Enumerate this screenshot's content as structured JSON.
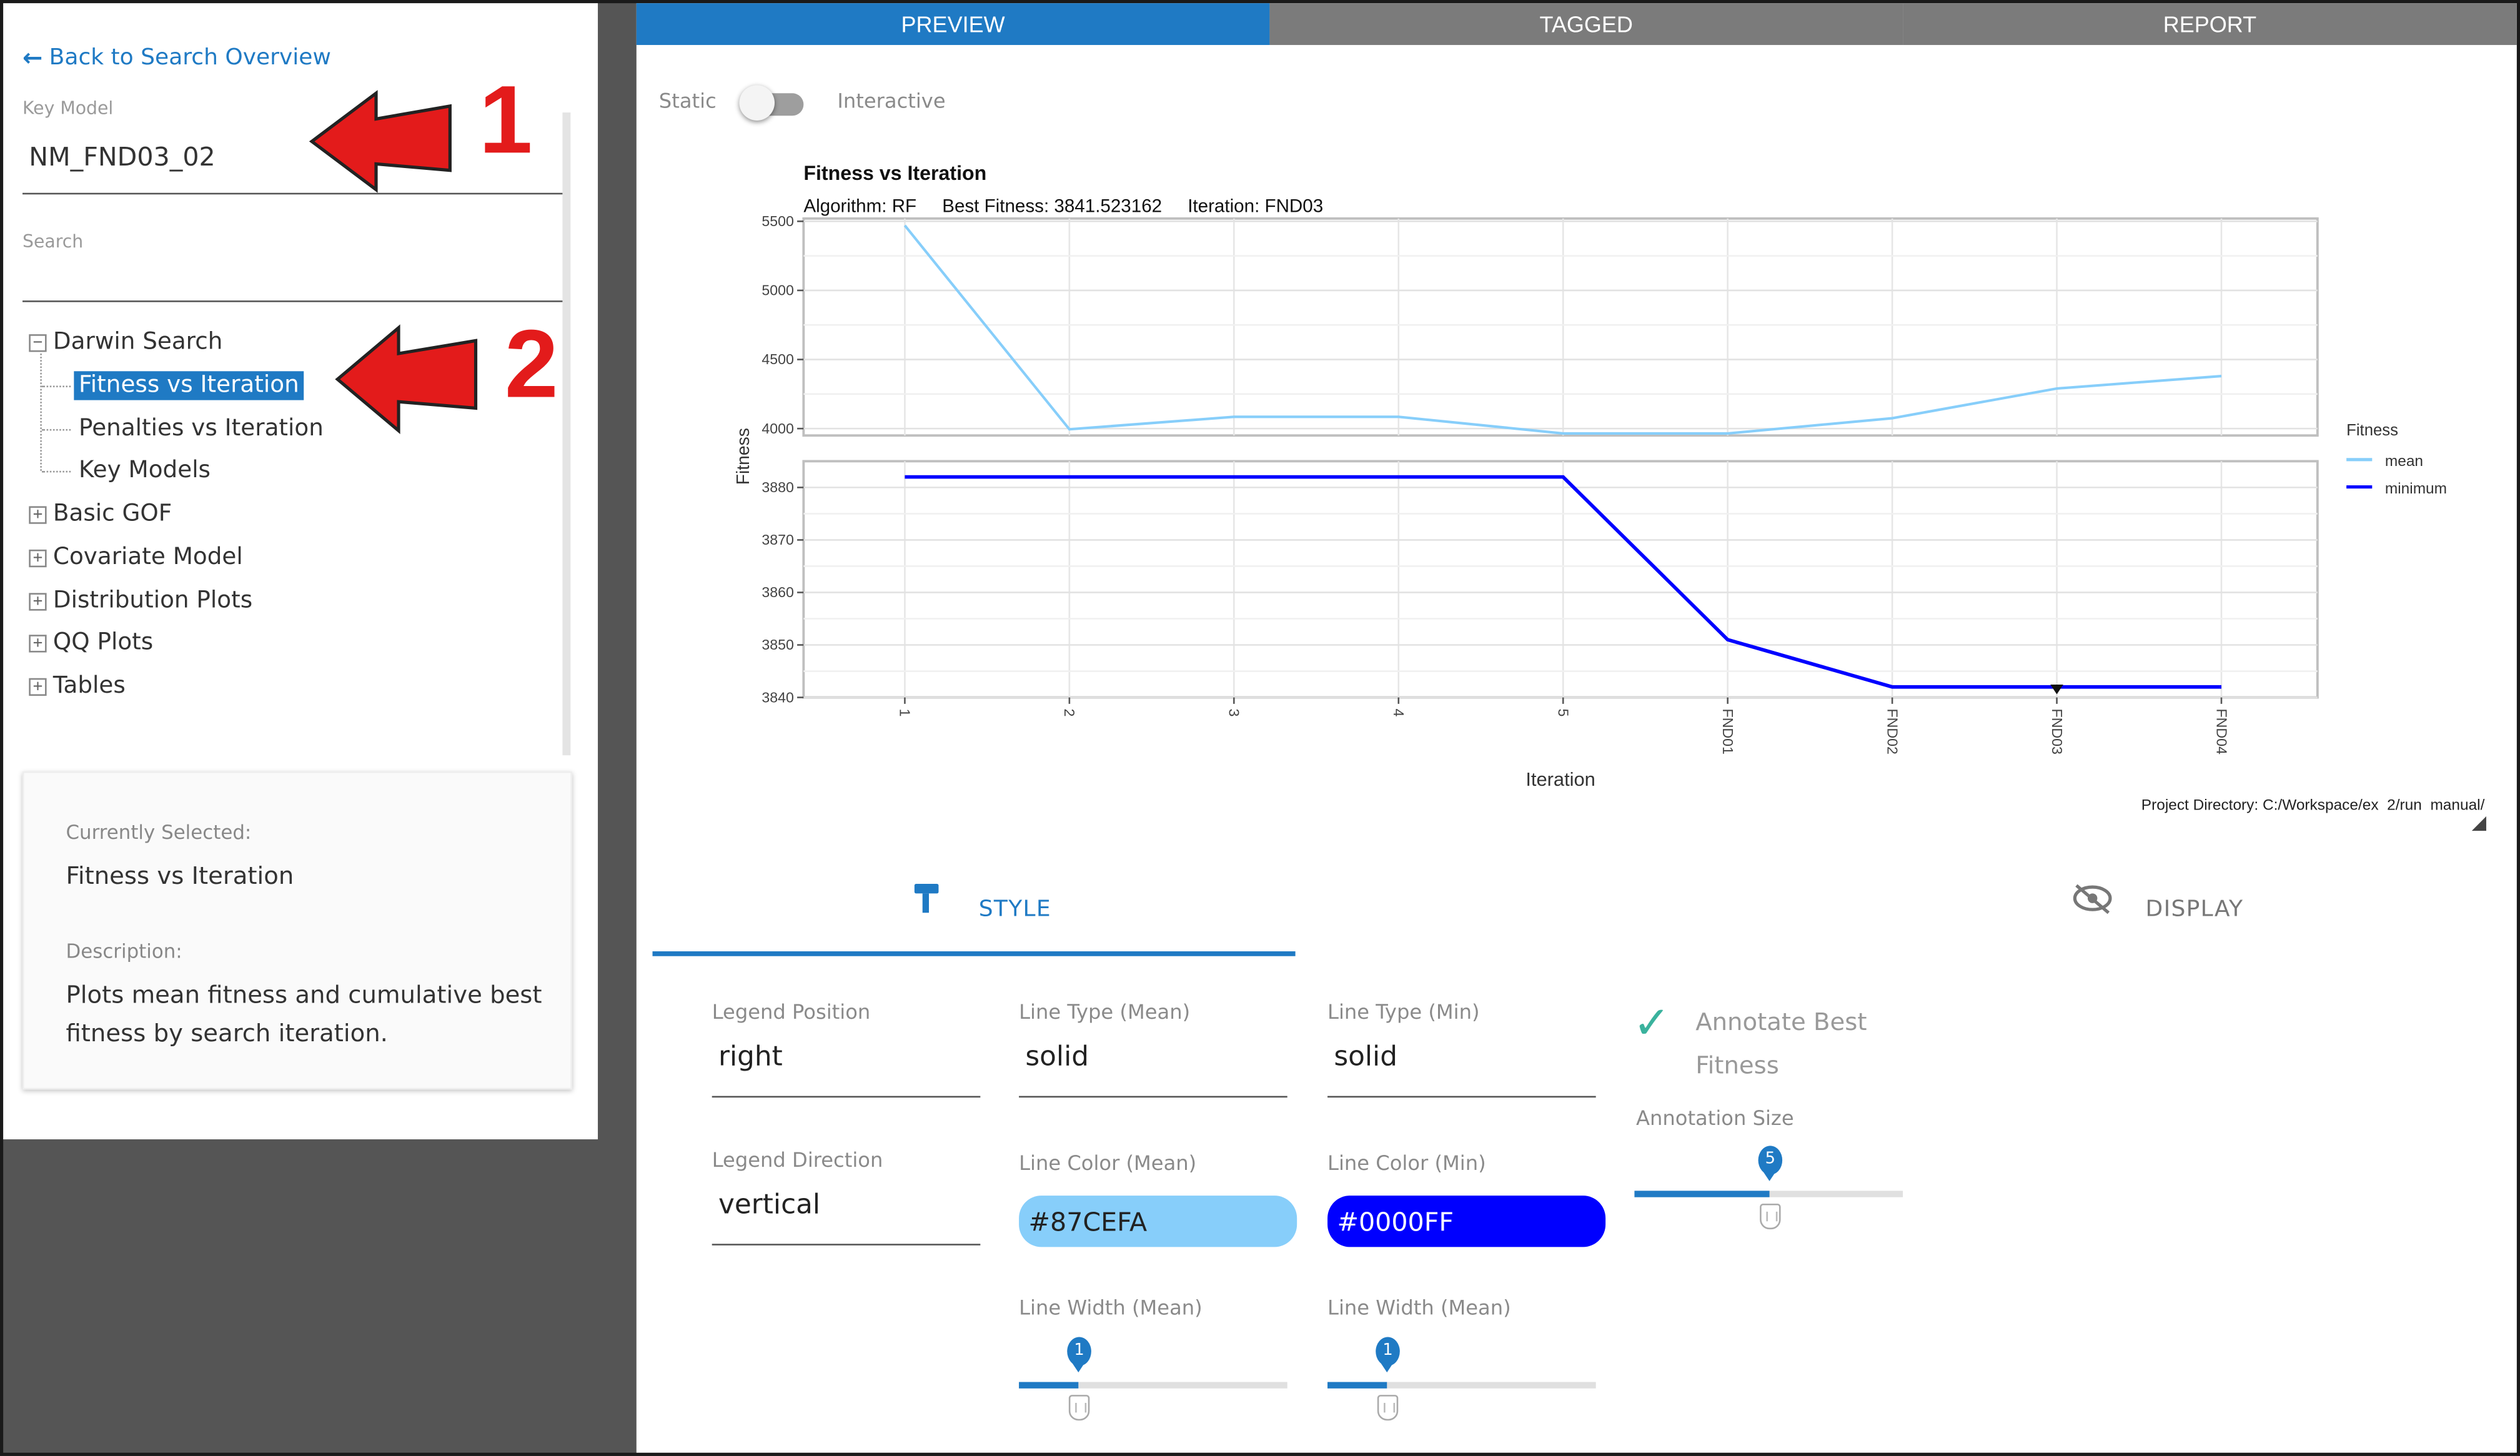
{
  "sidebar": {
    "back_link": "Back to Search Overview",
    "key_model_label": "Key Model",
    "key_model_value": "NM_FND03_02",
    "search_label": "Search",
    "tree": [
      {
        "label": "Darwin Search",
        "toggle": "−",
        "children": [
          "Fitness vs Iteration",
          "Penalties vs Iteration",
          "Key Models"
        ]
      },
      {
        "label": "Basic GOF",
        "toggle": "+"
      },
      {
        "label": "Covariate Model",
        "toggle": "+"
      },
      {
        "label": "Distribution Plots",
        "toggle": "+"
      },
      {
        "label": "QQ Plots",
        "toggle": "+"
      },
      {
        "label": "Tables",
        "toggle": "+"
      }
    ],
    "selected_item": "Fitness vs Iteration",
    "info": {
      "currently_selected_label": "Currently Selected:",
      "currently_selected_value": "Fitness vs Iteration",
      "description_label": "Description:",
      "description_line1": "Plots mean fitness and cumulative best",
      "description_line2": "fitness by search iteration."
    }
  },
  "annotations": {
    "one": "1",
    "two": "2",
    "arrow_color": "#e31b1b"
  },
  "tabs": [
    {
      "label": "PREVIEW",
      "active": true
    },
    {
      "label": "TAGGED",
      "active": false
    },
    {
      "label": "REPORT",
      "active": false
    }
  ],
  "toggle": {
    "left_label": "Static",
    "right_label": "Interactive",
    "state": "static"
  },
  "chart_data": {
    "type": "line",
    "title": "Fitness vs Iteration",
    "subtitle": "Algorithm: RF     Best Fitness: 3841.523162     Iteration: FND03",
    "xlabel": "Iteration",
    "ylabel": "Fitness",
    "categories": [
      "1",
      "2",
      "3",
      "4",
      "5",
      "FND01",
      "FND02",
      "FND03",
      "FND04"
    ],
    "legend_title": "Fitness",
    "legend_position": "right",
    "footer": "Project Directory: C:/Workspace/ex  2/run  manual/",
    "grid": true,
    "panels": [
      {
        "ylim": [
          3950,
          5520
        ],
        "yticks": [
          4000,
          4500,
          5000,
          5500
        ]
      },
      {
        "ylim": [
          3840,
          3885
        ],
        "yticks": [
          3840,
          3850,
          3860,
          3870,
          3880
        ]
      }
    ],
    "series": [
      {
        "name": "mean",
        "color": "#87CEFA",
        "panel": 0,
        "values": [
          5470,
          3995,
          4085,
          4085,
          3965,
          3965,
          4075,
          4290,
          4380
        ]
      },
      {
        "name": "minimum",
        "color": "#0000FF",
        "panel": 1,
        "values": [
          3882,
          3882,
          3882,
          3882,
          3882,
          3851,
          3842,
          3842,
          3842
        ]
      }
    ],
    "best_point": {
      "x": "FND03",
      "y": 3841.523162
    }
  },
  "panel_tabs": {
    "style": "STYLE",
    "display": "DISPLAY"
  },
  "controls": {
    "legend_position": {
      "label": "Legend Position",
      "value": "right"
    },
    "legend_direction": {
      "label": "Legend Direction",
      "value": "vertical"
    },
    "line_type_mean": {
      "label": "Line Type (Mean)",
      "value": "solid"
    },
    "line_type_min": {
      "label": "Line Type (Min)",
      "value": "solid"
    },
    "line_color_mean": {
      "label": "Line Color (Mean)",
      "value": "#87CEFA",
      "color": "#87CEFA"
    },
    "line_color_min": {
      "label": "Line Color (Min)",
      "value": "#0000FF",
      "color": "#0000FF"
    },
    "line_width_mean": {
      "label": "Line Width (Mean)",
      "value": "1",
      "fraction": 0.22
    },
    "line_width_min": {
      "label": "Line Width (Mean)",
      "value": "1",
      "fraction": 0.22
    },
    "annotate_best": {
      "label_line1": "Annotate Best",
      "label_line2": "Fitness",
      "checked": true
    },
    "annotation_size": {
      "label": "Annotation Size",
      "value": "5",
      "fraction": 0.5
    }
  }
}
